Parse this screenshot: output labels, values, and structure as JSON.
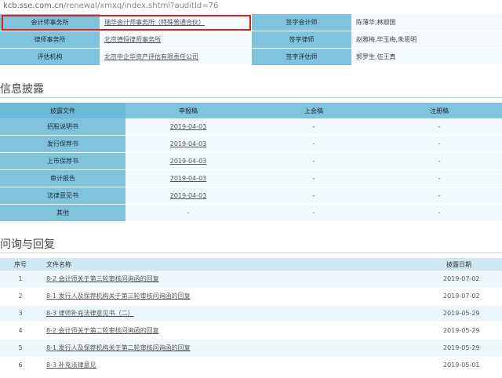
{
  "url": {
    "host": "kcb.sse.com.cn",
    "path": "/renewal/xmxq/index.shtml?auditId=76"
  },
  "agencies": [
    {
      "label1": "会计师事务所",
      "value1": "瑞华会计师事务所（特殊普通合伙）",
      "label2": "签字会计师",
      "value2": "陈薄华,林顺国"
    },
    {
      "label1": "律师事务所",
      "value1": "北京德恒律师事务所",
      "label2": "签字律师",
      "value2": "赵雅梅,毕玉梅,朱思明"
    },
    {
      "label1": "评估机构",
      "value1": "北京中企华资产评估有限责任公司",
      "label2": "签字评估师",
      "value2": "郭罗生,伍王真"
    }
  ],
  "disclosure": {
    "title": "信息披露",
    "headers": [
      "披露文件",
      "申报稿",
      "上会稿",
      "注册稿"
    ],
    "rows": [
      {
        "name": "招股说明书",
        "c1": "2019-04-03",
        "c2": "-",
        "c3": "-"
      },
      {
        "name": "发行保荐书",
        "c1": "2019-04-03",
        "c2": "-",
        "c3": "-"
      },
      {
        "name": "上市保荐书",
        "c1": "2019-04-03",
        "c2": "-",
        "c3": "-"
      },
      {
        "name": "审计报告",
        "c1": "2019-04-03",
        "c2": "-",
        "c3": "-"
      },
      {
        "name": "法律意见书",
        "c1": "2019-04-03",
        "c2": "-",
        "c3": "-"
      },
      {
        "name": "其他",
        "c1": "-",
        "c2": "-",
        "c3": "-"
      }
    ]
  },
  "qa": {
    "title": "问询与回复",
    "headers": [
      "序号",
      "文件名称",
      "披露日期"
    ],
    "rows": [
      {
        "no": "1",
        "name": "8-2 会计师关于第三轮审核问询函的回复",
        "date": "2019-07-02"
      },
      {
        "no": "2",
        "name": "8-1 发行人及保荐机构关于第三轮审核问询函的回复",
        "date": "2019-07-02"
      },
      {
        "no": "3",
        "name": "8-3 律师补充法律意见书（二）",
        "date": "2019-05-29"
      },
      {
        "no": "4",
        "name": "8-2 会计师关于第二轮审核问询函的回复",
        "date": "2019-05-29"
      },
      {
        "no": "5",
        "name": "8-1 发行人及保荐机构关于第二轮审核问询函的回复",
        "date": "2019-05-29"
      },
      {
        "no": "6",
        "name": "8-3 补充法律意见",
        "date": "2019-05-01"
      }
    ]
  }
}
